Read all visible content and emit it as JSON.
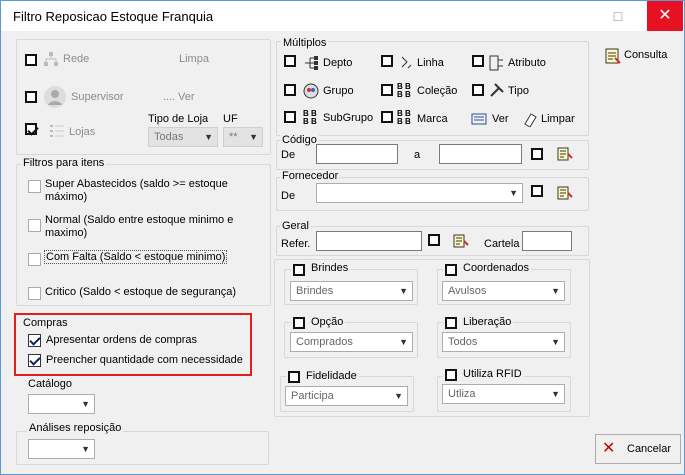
{
  "window": {
    "title": "Filtro Reposicao Estoque Franquia",
    "close": "✕"
  },
  "top_left": {
    "rede": "Rede",
    "limpa": "Limpa",
    "supervisor": "Supervisor",
    "ver": "Ver",
    "lojas": "Lojas",
    "tipo_de_loja_label": "Tipo de Loja",
    "tipo_de_loja_value": "Todas",
    "uf_label": "UF",
    "uf_value": "**"
  },
  "filtros": {
    "legend": "Filtros para itens",
    "items": [
      "Super Abastecidos  (saldo >= estoque máximo)",
      "Normal (Saldo entre estoque minimo e maximo)",
      "Com Falta (Saldo < estoque minimo)",
      "Critico (Saldo < estoque de segurança)"
    ]
  },
  "compras": {
    "legend": "Compras",
    "items": [
      "Apresentar ordens de compras",
      "Preencher quantidade com necessidade"
    ]
  },
  "catalogo": {
    "label": "Catálogo",
    "value": ""
  },
  "analises": {
    "label": "Análises reposição",
    "value": ""
  },
  "multiplos": {
    "legend": "Múltiplos",
    "items": [
      "Depto",
      "Linha",
      "Atributo",
      "Grupo",
      "Coleção",
      "Tipo",
      "SubGrupo",
      "Marca"
    ],
    "ver": "Ver",
    "limpar": "Limpar"
  },
  "codigo": {
    "legend": "Código",
    "de": "De",
    "a": "a"
  },
  "fornecedor": {
    "legend": "Fornecedor",
    "de": "De"
  },
  "geral": {
    "legend": "Geral",
    "refer": "Refer.",
    "cartela": "Cartela"
  },
  "dropdowns": {
    "brindes": {
      "label": "Brindes",
      "value": "Brindes"
    },
    "coordenados": {
      "label": "Coordenados",
      "value": "Avulsos"
    },
    "opcao": {
      "label": "Opção",
      "value": "Comprados"
    },
    "liberacao": {
      "label": "Liberação",
      "value": "Todos"
    },
    "fidelidade": {
      "label": "Fidelidade",
      "value": "Participa"
    },
    "rfid": {
      "label": "Utiliza RFID",
      "value": "Utliza"
    }
  },
  "buttons": {
    "consulta": "Consulta",
    "cancelar": "Cancelar"
  },
  "colors": {
    "close_bg": "#e81123",
    "highlight": "#e02020",
    "window_border": "#5b9bd5"
  }
}
